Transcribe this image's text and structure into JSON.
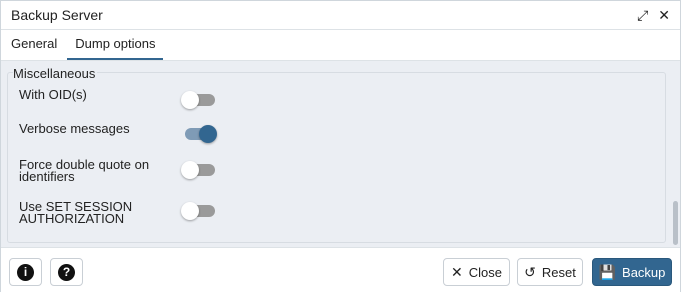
{
  "dialog": {
    "title": "Backup Server",
    "expand_icon": "⤢",
    "close_icon": "✕"
  },
  "tabs": [
    {
      "label": "General",
      "active": false
    },
    {
      "label": "Dump options",
      "active": true
    }
  ],
  "section": {
    "legend": "Miscellaneous",
    "options": [
      {
        "label": "With OID(s)",
        "enabled": false
      },
      {
        "label": "Verbose messages",
        "enabled": true
      },
      {
        "label": "Force double quote on identifiers",
        "enabled": false
      },
      {
        "label": "Use SET SESSION AUTHORIZATION",
        "enabled": false
      }
    ]
  },
  "footer": {
    "info_icon": "i",
    "help_icon": "?",
    "close_label": "Close",
    "close_icon": "✕",
    "reset_label": "Reset",
    "reset_icon": "↺",
    "backup_label": "Backup",
    "backup_icon": "💾"
  },
  "colors": {
    "accent": "#326690",
    "panel_bg": "#ebeef3"
  }
}
